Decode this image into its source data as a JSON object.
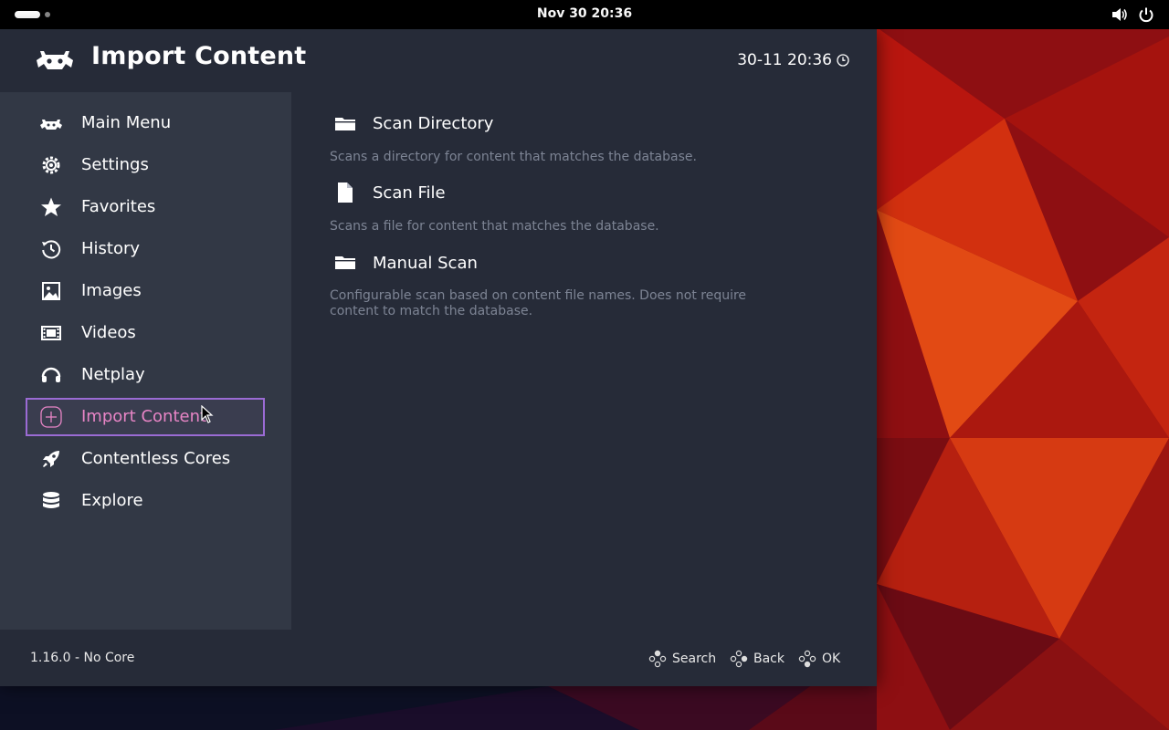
{
  "topbar": {
    "clock": "Nov 30  20:36",
    "icons": [
      "activities-indicator",
      "volume-icon",
      "power-icon"
    ]
  },
  "header": {
    "title": "Import Content",
    "datetime": "30-11 20:36",
    "icons": [
      "retroarch-logo-icon",
      "clock-icon"
    ]
  },
  "sidebar": {
    "items": [
      {
        "label": "Main Menu",
        "icon": "invader-icon",
        "active": false
      },
      {
        "label": "Settings",
        "icon": "gear-icon",
        "active": false
      },
      {
        "label": "Favorites",
        "icon": "star-icon",
        "active": false
      },
      {
        "label": "History",
        "icon": "history-icon",
        "active": false
      },
      {
        "label": "Images",
        "icon": "image-icon",
        "active": false
      },
      {
        "label": "Videos",
        "icon": "film-icon",
        "active": false
      },
      {
        "label": "Netplay",
        "icon": "headset-icon",
        "active": false
      },
      {
        "label": "Import Content",
        "icon": "plus-circle-icon",
        "active": true
      },
      {
        "label": "Contentless Cores",
        "icon": "rocket-icon",
        "active": false
      },
      {
        "label": "Explore",
        "icon": "database-icon",
        "active": false
      }
    ]
  },
  "content": {
    "entries": [
      {
        "title": "Scan Directory",
        "icon": "folder-icon",
        "desc": "Scans a directory for content that matches the database."
      },
      {
        "title": "Scan File",
        "icon": "file-icon",
        "desc": "Scans a file for content that matches the database."
      },
      {
        "title": "Manual Scan",
        "icon": "folder-icon",
        "desc": "Configurable scan based on content file names. Does not require content to match the database."
      }
    ]
  },
  "footer": {
    "version": "1.16.0 - No Core",
    "hints": [
      {
        "label": "Search",
        "icon": "gamepad-buttons-icon"
      },
      {
        "label": "Back",
        "icon": "gamepad-buttons-icon"
      },
      {
        "label": "OK",
        "icon": "gamepad-buttons-icon"
      }
    ]
  },
  "colors": {
    "window_bg": "#262b38",
    "sidebar_bg": "#323845",
    "active_border": "#9b6bd4",
    "active_text": "#e885c6",
    "desc_text": "#7d8494"
  }
}
